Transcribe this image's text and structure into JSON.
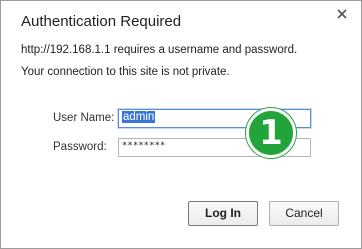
{
  "dialog": {
    "title": "Authentication Required",
    "message_line1": "http://192.168.1.1 requires a username and password.",
    "message_line2": "Your connection to this site is not private.",
    "close_icon": "close-icon"
  },
  "form": {
    "username_label": "User Name:",
    "username_value": "admin",
    "password_label": "Password:",
    "password_value": "********"
  },
  "badge": {
    "text": "1",
    "color": "#22a43a"
  },
  "buttons": {
    "login_label": "Log In",
    "cancel_label": "Cancel"
  }
}
